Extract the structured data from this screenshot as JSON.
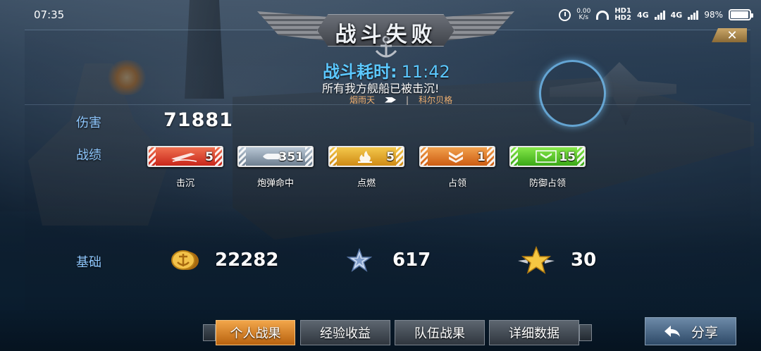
{
  "status_bar": {
    "time": "07:35",
    "net_speed_value": "0.00",
    "net_speed_unit": "K/s",
    "hd1": "HD1",
    "hd2": "HD2",
    "sim1_type": "4G",
    "sim2_type": "4G",
    "battery": "98%",
    "battery_level": 0.98
  },
  "header": {
    "title": "战斗失败",
    "close_symbol": "✕"
  },
  "summary": {
    "battle_time_label": "战斗耗时:",
    "battle_time_value": "11:42",
    "message": "所有我方舰船已被击沉!",
    "killer": "烟雨天",
    "separator": "|",
    "victim": "科尔贝格"
  },
  "stats": {
    "damage_label": "伤害",
    "damage_value": "71881",
    "record_label": "战绩",
    "records": [
      {
        "label": "击沉",
        "count": "5",
        "color": "red",
        "icon": "sinking-ship-icon"
      },
      {
        "label": "炮弹命中",
        "count": "351",
        "color": "steel",
        "icon": "shell-icon"
      },
      {
        "label": "点燃",
        "count": "5",
        "color": "gold",
        "icon": "fire-icon"
      },
      {
        "label": "占领",
        "count": "1",
        "color": "orange",
        "icon": "chevron-rank-icon"
      },
      {
        "label": "防御占领",
        "count": "15",
        "color": "green",
        "icon": "defend-capture-icon"
      }
    ],
    "base_label": "基础",
    "base": {
      "coins": "22282",
      "experience": "617",
      "rank_points": "30"
    }
  },
  "tabs": [
    {
      "label": "个人战果",
      "active": true
    },
    {
      "label": "经验收益",
      "active": false
    },
    {
      "label": "队伍战果",
      "active": false
    },
    {
      "label": "详细数据",
      "active": false
    }
  ],
  "share_label": "分享"
}
